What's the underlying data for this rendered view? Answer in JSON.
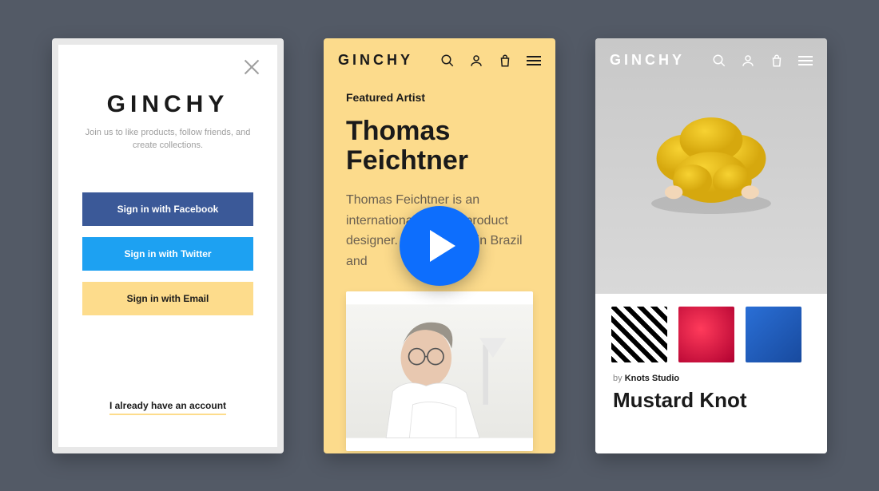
{
  "brand": "GINCHY",
  "colors": {
    "background": "#535A66",
    "accent": "#FCDB8C",
    "facebook": "#3b5998",
    "twitter": "#1da1f2",
    "play": "#0d6efd"
  },
  "screen1": {
    "logo": "GINCHY",
    "subtitle": "Join us to like products, follow friends, and create collections.",
    "buttons": {
      "facebook": "Sign in with Facebook",
      "twitter": "Sign in with Twitter",
      "email": "Sign in with Email"
    },
    "existing_account_link": "I already have an account"
  },
  "screen2": {
    "eyebrow": "Featured Artist",
    "title": "Thomas Feichtner",
    "description": "Thomas Feichtner is an internationally active product designer. He was born in Brazil and"
  },
  "screen3": {
    "by_prefix": "by ",
    "by_name": "Knots Studio",
    "product_title": "Mustard Knot"
  },
  "icons": {
    "search": "search-icon",
    "user": "user-icon",
    "bag": "bag-icon",
    "menu": "menu-icon",
    "close": "close-icon",
    "play": "play-icon"
  }
}
